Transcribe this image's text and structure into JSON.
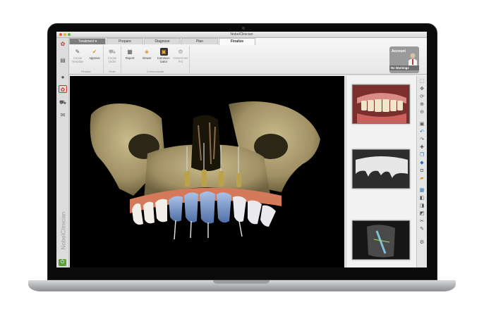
{
  "window": {
    "title": "NobelClinician"
  },
  "tabs": [
    "Treatment",
    "Prepare",
    "Diagnose",
    "Plan",
    "Finalize"
  ],
  "ribbon": {
    "groups": [
      {
        "name": "Finalize",
        "buttons": [
          {
            "label": "Create Template",
            "dim": true,
            "icon": "template-icon"
          },
          {
            "label": "Approve",
            "dim": false,
            "icon": "approve-icon"
          }
        ]
      },
      {
        "name": "Order",
        "buttons": [
          {
            "label": "Create Order",
            "dim": true,
            "icon": "cart-icon"
          }
        ]
      },
      {
        "name": "Communicate",
        "buttons": [
          {
            "label": "Report",
            "dim": false,
            "icon": "report-icon"
          },
          {
            "label": "Viewer",
            "dim": false,
            "icon": "viewer-icon"
          },
          {
            "label": "Commun-icator",
            "dim": false,
            "icon": "communicator-icon"
          },
          {
            "label": "OsseoCare Pro",
            "dim": true,
            "icon": "osseocare-icon"
          }
        ]
      }
    ]
  },
  "account": {
    "title": "Account",
    "warnings": "No Warnings"
  },
  "sidebar": {
    "brand": "NobelClinician"
  },
  "colors": {
    "accent": "#7d7d7d",
    "bone": "#a99b6e",
    "gum": "#d47a5a",
    "crown": "#6f8fc0",
    "implant": "#b9a24a"
  },
  "thumbnails": [
    "clinical-photo",
    "model-scan",
    "cbct-slice"
  ]
}
